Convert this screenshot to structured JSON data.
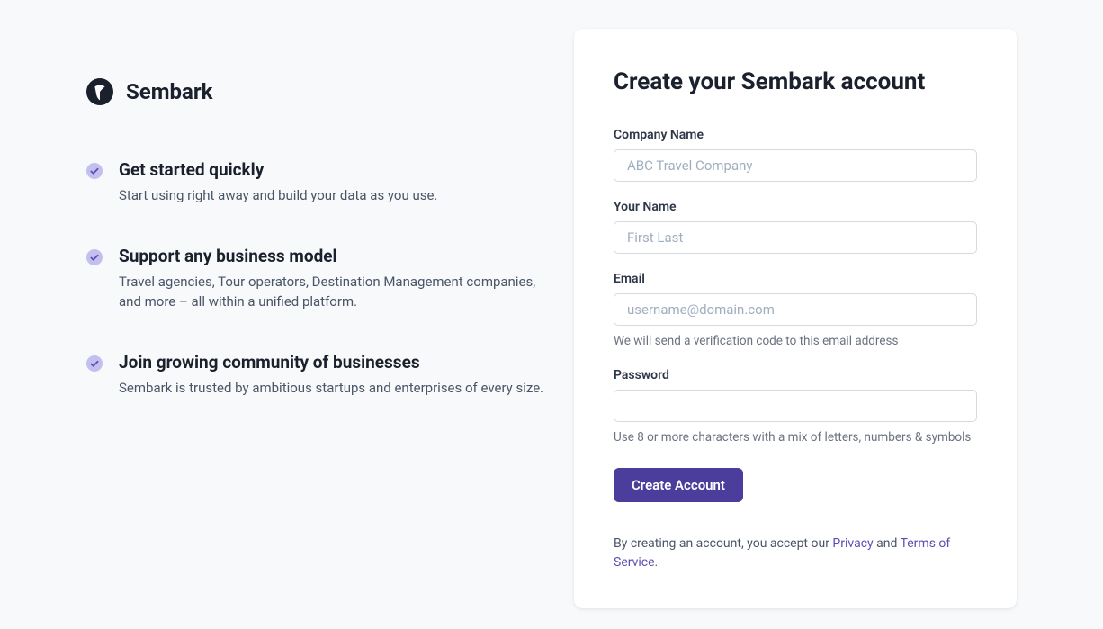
{
  "brand": {
    "name": "Sembark"
  },
  "features": [
    {
      "title": "Get started quickly",
      "desc": "Start using right away and build your data as you use."
    },
    {
      "title": "Support any business model",
      "desc": "Travel agencies, Tour operators, Destination Management companies, and more – all within a unified platform."
    },
    {
      "title": "Join growing community of businesses",
      "desc": "Sembark is trusted by ambitious startups and enterprises of every size."
    }
  ],
  "form": {
    "title": "Create your Sembark account",
    "company": {
      "label": "Company Name",
      "placeholder": "ABC Travel Company"
    },
    "name": {
      "label": "Your Name",
      "placeholder": "First Last"
    },
    "email": {
      "label": "Email",
      "placeholder": "username@domain.com",
      "help": "We will send a verification code to this email address"
    },
    "password": {
      "label": "Password",
      "help": "Use 8 or more characters with a mix of letters, numbers & symbols"
    },
    "submit": "Create Account",
    "terms": {
      "prefix": "By creating an account, you accept our ",
      "privacy": "Privacy",
      "and": " and ",
      "tos": "Terms of Service",
      "suffix": "."
    }
  }
}
